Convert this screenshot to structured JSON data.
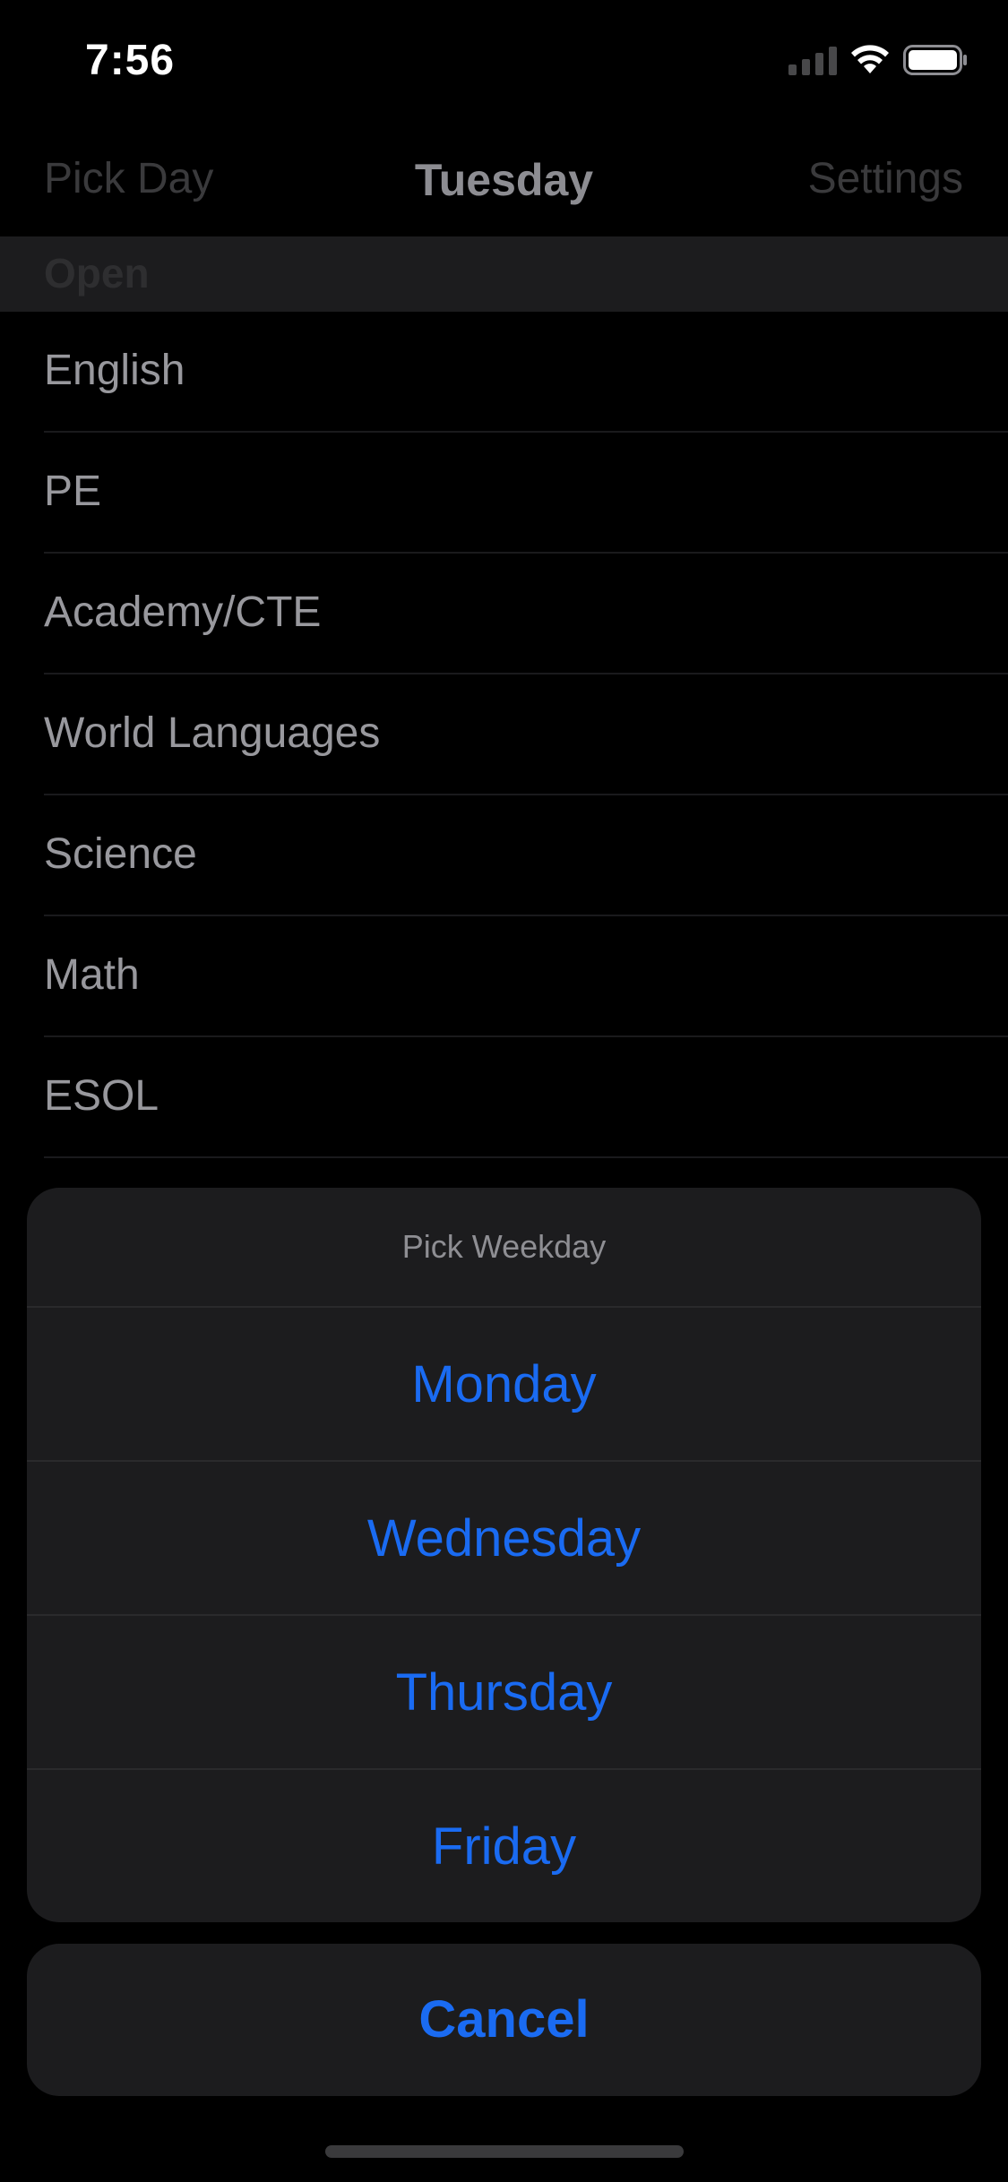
{
  "status_bar": {
    "time": "7:56",
    "icons": [
      "signal-icon",
      "wifi-icon",
      "battery-icon"
    ]
  },
  "nav": {
    "left_label": "Pick Day",
    "title": "Tuesday",
    "right_label": "Settings"
  },
  "section": {
    "header": "Open"
  },
  "subjects": [
    {
      "label": "English"
    },
    {
      "label": "PE"
    },
    {
      "label": "Academy/CTE"
    },
    {
      "label": "World Languages"
    },
    {
      "label": "Science"
    },
    {
      "label": "Math"
    },
    {
      "label": "ESOL"
    }
  ],
  "action_sheet": {
    "title": "Pick Weekday",
    "options": [
      "Monday",
      "Wednesday",
      "Thursday",
      "Friday"
    ],
    "cancel": "Cancel"
  },
  "colors": {
    "accent": "#1a6bf2",
    "background": "#000000",
    "sheet_background": "#1c1c1e"
  }
}
